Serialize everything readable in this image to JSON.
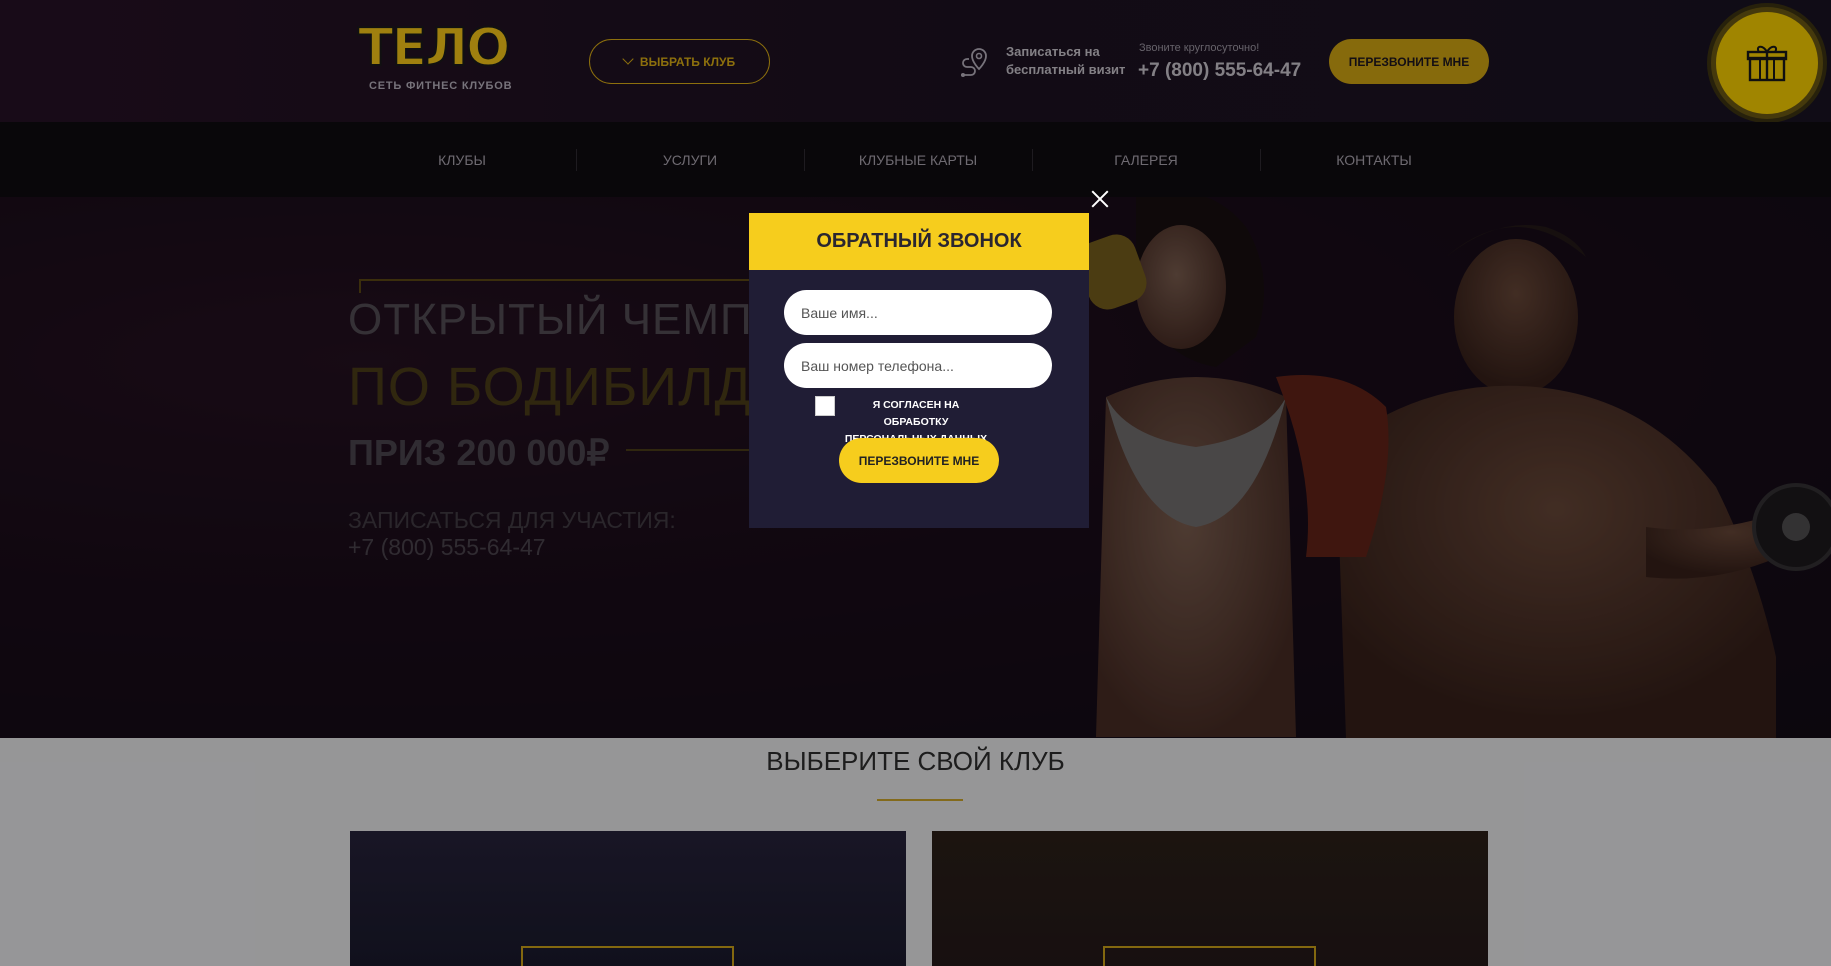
{
  "header": {
    "logo_word": "ТЕЛО",
    "logo_subtitle": "СЕТЬ ФИТНЕС КЛУБОВ",
    "select_club_label": "ВЫБРАТЬ КЛУБ",
    "visit_line1": "Записаться на",
    "visit_line2": "бесплатный визит",
    "call_hint": "Звоните круглосуточно!",
    "phone": "+7 (800) 555-64-47",
    "callback_label": "ПЕРЕЗВОНИТЕ МНЕ"
  },
  "nav": {
    "items": [
      {
        "label": "КЛУБЫ"
      },
      {
        "label": "УСЛУГИ"
      },
      {
        "label": "КЛУБНЫЕ КАРТЫ"
      },
      {
        "label": "ГАЛЕРЕЯ"
      },
      {
        "label": "КОНТАКТЫ"
      }
    ]
  },
  "hero": {
    "line1": "ОТКРЫТЫЙ ЧЕМПИ",
    "line2": "ПО БОДИБИЛД",
    "prize": "ПРИЗ 200 000₽",
    "signup": "ЗАПИСАТЬСЯ ДЛЯ УЧАСТИЯ:",
    "phone": "+7 (800) 555-64-47"
  },
  "modal": {
    "title": "ОБРАТНЫЙ ЗВОНОК",
    "name_placeholder": "Ваше имя...",
    "phone_placeholder": "Ваш номер телефона...",
    "consent_line1": "Я СОГЛАСЕН НА ОБРАБОТКУ",
    "consent_line2": "ПЕРСОНАЛЬНЫХ ДАННЫХ",
    "submit_label": "ПЕРЕЗВОНИТЕ МНЕ"
  },
  "clubs": {
    "title": "ВЫБЕРИТЕ СВОЙ КЛУБ"
  },
  "colors": {
    "accent": "#f6cd1d",
    "header_bg": "#1e1221",
    "nav_bg": "#0f0b10",
    "modal_bg": "#201d35"
  },
  "icons": [
    "map-pin-route-icon",
    "gift-icon",
    "chevron-down-icon",
    "close-icon"
  ]
}
